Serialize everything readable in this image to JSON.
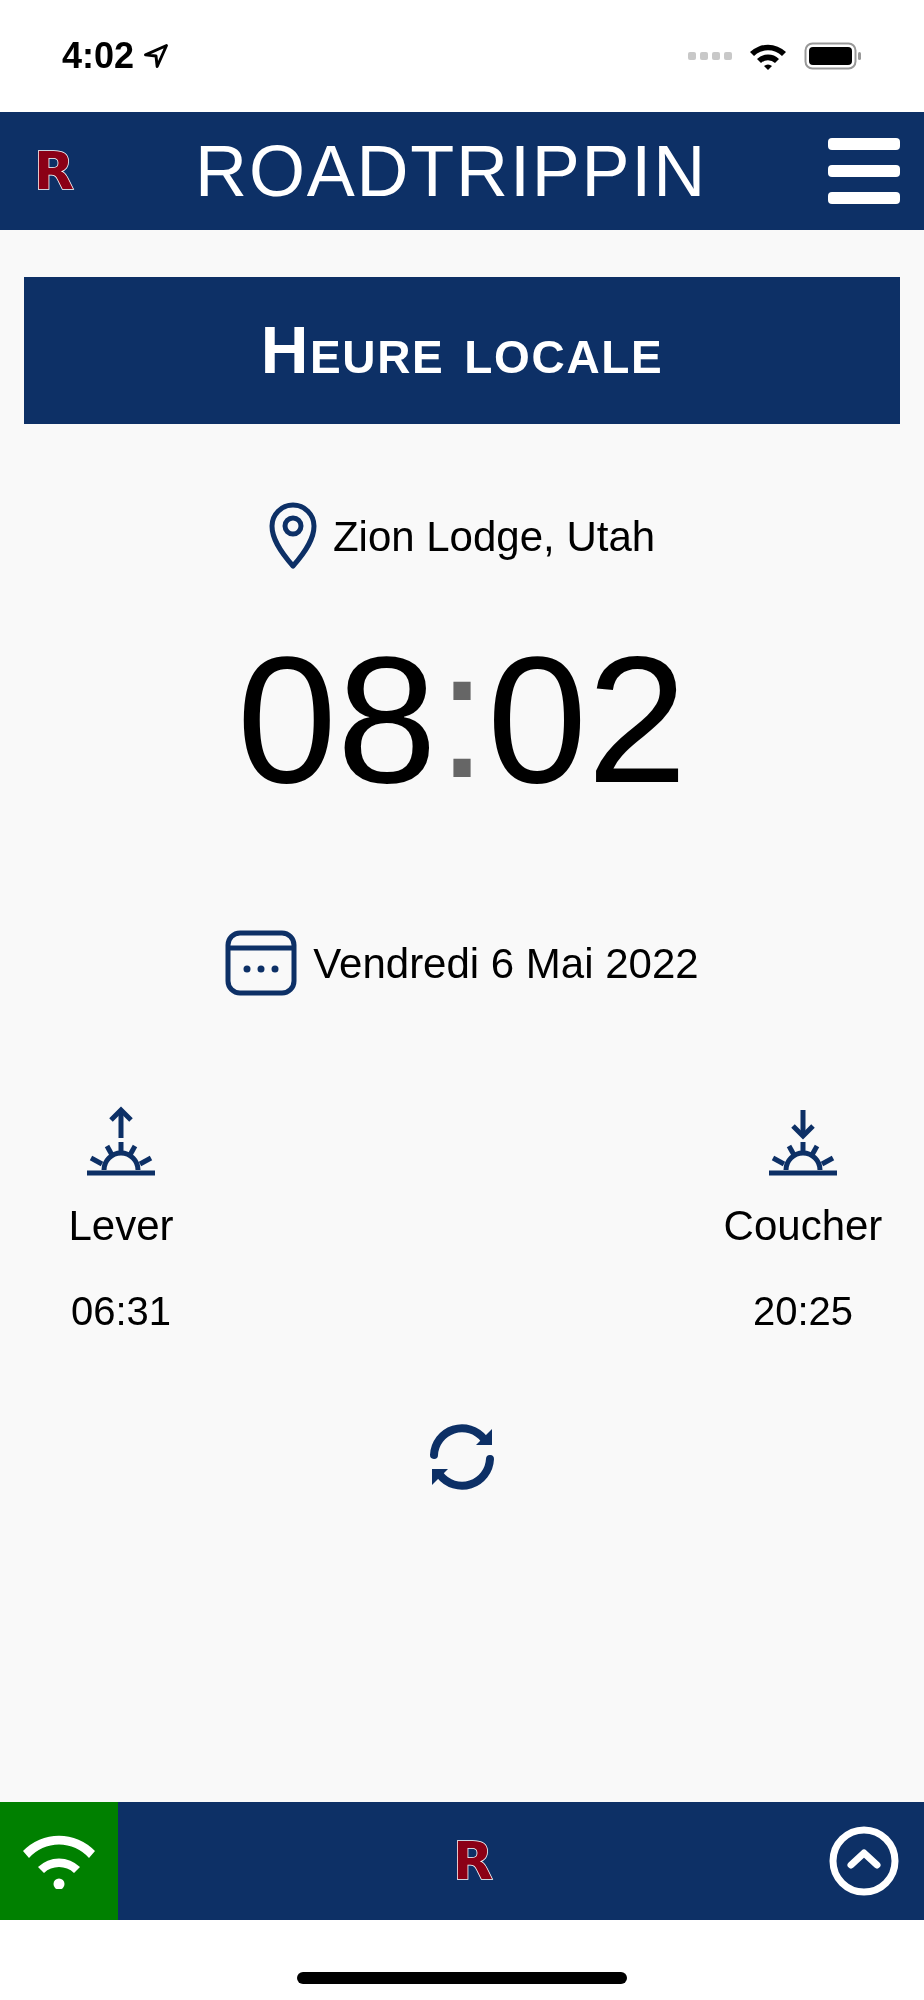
{
  "status_bar": {
    "time": "4:02"
  },
  "header": {
    "logo": "R",
    "title": "ROADTRIPPIN"
  },
  "banner": {
    "title": "Heure locale"
  },
  "location": {
    "name": "Zion Lodge, Utah"
  },
  "clock": {
    "hours": "08",
    "separator": ":",
    "minutes": "02"
  },
  "date": {
    "text": "Vendredi 6 Mai 2022"
  },
  "sun": [
    {
      "kind": "sunrise",
      "label": "Lever",
      "time": "06:31"
    },
    {
      "kind": "sunset",
      "label": "Coucher",
      "time": "20:25"
    }
  ],
  "bottom_bar": {
    "online": true,
    "logo": "R"
  }
}
